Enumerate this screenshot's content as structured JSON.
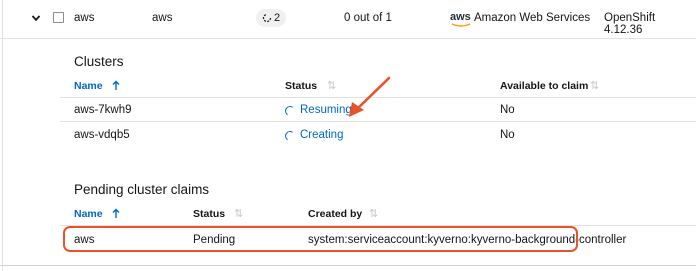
{
  "row": {
    "name": "aws",
    "namespace": "aws",
    "cluster_count": "2",
    "claim_ratio": "0 out of 1",
    "provider_logo_text": "aws",
    "provider_name": "Amazon Web Services",
    "distribution": "OpenShift 4.12.36"
  },
  "clusters": {
    "title": "Clusters",
    "columns": {
      "name": "Name",
      "status": "Status",
      "available": "Available to claim"
    },
    "rows": [
      {
        "name": "aws-7kwh9",
        "status": "Resuming",
        "available": "No"
      },
      {
        "name": "aws-vdqb5",
        "status": "Creating",
        "available": "No"
      }
    ]
  },
  "pending": {
    "title": "Pending cluster claims",
    "columns": {
      "name": "Name",
      "status": "Status",
      "created_by": "Created by"
    },
    "rows": [
      {
        "name": "aws",
        "status": "Pending",
        "created_by": "system:serviceaccount:kyverno:kyverno-background-controller"
      }
    ]
  },
  "icons": {
    "expand": "chevron-down-icon",
    "sort_active": "arrow-up-icon",
    "sort_idle": "sort-icon",
    "spinner": "spinner-icon",
    "annotation_arrow": "red-arrow",
    "sync": "sync-icon"
  },
  "colors": {
    "link": "#0066cc",
    "annotation": "#e65427",
    "aws_smile": "#ff9900"
  }
}
